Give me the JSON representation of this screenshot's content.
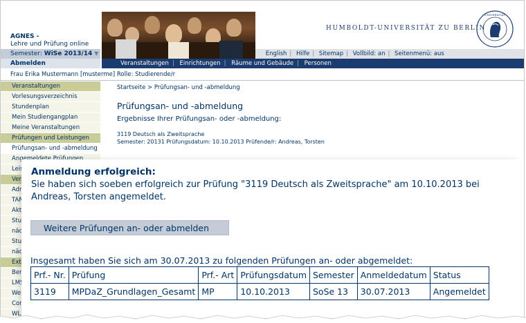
{
  "header": {
    "brand_title": "AGNES -",
    "brand_subtitle": "Lehre und Prüfung online",
    "university": "HUMBOLDT-UNIVERSITÄT ZU BERLIN",
    "semester_label": "Semester:",
    "semester_value": "WiSe 2013/14",
    "top_links": [
      "English",
      "Hilfe",
      "Sitemap",
      "Vollbild: an",
      "Seitenmenü: aus"
    ],
    "logout_label": "Abmelden",
    "main_nav": [
      "Veranstaltungen",
      "Einrichtungen",
      "Räume und Gebäude",
      "Personen"
    ],
    "user_line": "Frau Erika Mustermann [musterme] Rolle: Studierende/r"
  },
  "sidebar": {
    "items": [
      {
        "label": "Veranstaltungen",
        "type": "head"
      },
      {
        "label": "Vorlesungsverzeichnis",
        "type": "item"
      },
      {
        "label": "Stundenplan",
        "type": "item"
      },
      {
        "label": "Mein Studiengangplan",
        "type": "item"
      },
      {
        "label": "Meine Veranstaltungen",
        "type": "item"
      },
      {
        "label": "Prüfungen und Leistungen",
        "type": "head"
      },
      {
        "label": "Prüfungsan- und -abmeldung",
        "type": "active"
      },
      {
        "label": "Angemeldete Prüfungen",
        "type": "item"
      },
      {
        "label": "Leis",
        "type": "item"
      },
      {
        "label": "Ver",
        "type": "head"
      },
      {
        "label": "Adr",
        "type": "item"
      },
      {
        "label": "TAN",
        "type": "item"
      },
      {
        "label": "Akt",
        "type": "item"
      },
      {
        "label": "Stu",
        "type": "item"
      },
      {
        "label": "näc",
        "type": "item"
      },
      {
        "label": "Stu",
        "type": "item"
      },
      {
        "label": "näc",
        "type": "item"
      },
      {
        "label": "Ext",
        "type": "head"
      },
      {
        "label": "Ber",
        "type": "item"
      },
      {
        "label": "LMS",
        "type": "item"
      },
      {
        "label": "Wel",
        "type": "item"
      },
      {
        "label": "Con",
        "type": "item"
      },
      {
        "label": "WLAN-Zugang",
        "type": "item"
      }
    ]
  },
  "content": {
    "breadcrumb": "Startseite > Prüfungsan- und -abmeldung",
    "title": "Prüfungsan- und -abmeldung",
    "subtitle": "Ergebnisse Ihrer Prüfungsan- oder -abmeldung:",
    "info_line1": "3119 Deutsch als Zweitsprache",
    "info_line2": "Semester: 20131 Prüfungsdatum: 10.10.2013 Prüfende/r: Andreas, Torsten"
  },
  "result": {
    "heading": "Anmeldung erfolgreich:",
    "message": "Sie haben sich soeben erfolgreich zur Prüfung \"3119 Deutsch als Zweitsprache\" am 10.10.2013 bei Andreas, Torsten angemeldet.",
    "more_button": "Weitere Prüfungen an- oder abmelden",
    "summary": "Insgesamt haben Sie sich am 30.07.2013 zu folgenden Prüfungen an- oder abgemeldet:",
    "table": {
      "headers": [
        "Prf.- Nr.",
        "Prüfung",
        "Prf.- Art",
        "Prüfungsdatum",
        "Semester",
        "Anmeldedatum",
        "Status"
      ],
      "rows": [
        [
          "3119",
          "MPDaZ_Grundlagen_Gesamt",
          "MP",
          "10.10.2013",
          "SoSe 13",
          "30.07.2013",
          "Angemeldet"
        ]
      ]
    }
  },
  "colors": {
    "primary": "#003366",
    "nav_bar": "#1b3c6e",
    "sidebar_head": "#c9cc97",
    "button_bg": "#c3ccd7"
  },
  "icons": {
    "seal": "university-seal-icon",
    "dropdown": "triangle-down-icon"
  }
}
